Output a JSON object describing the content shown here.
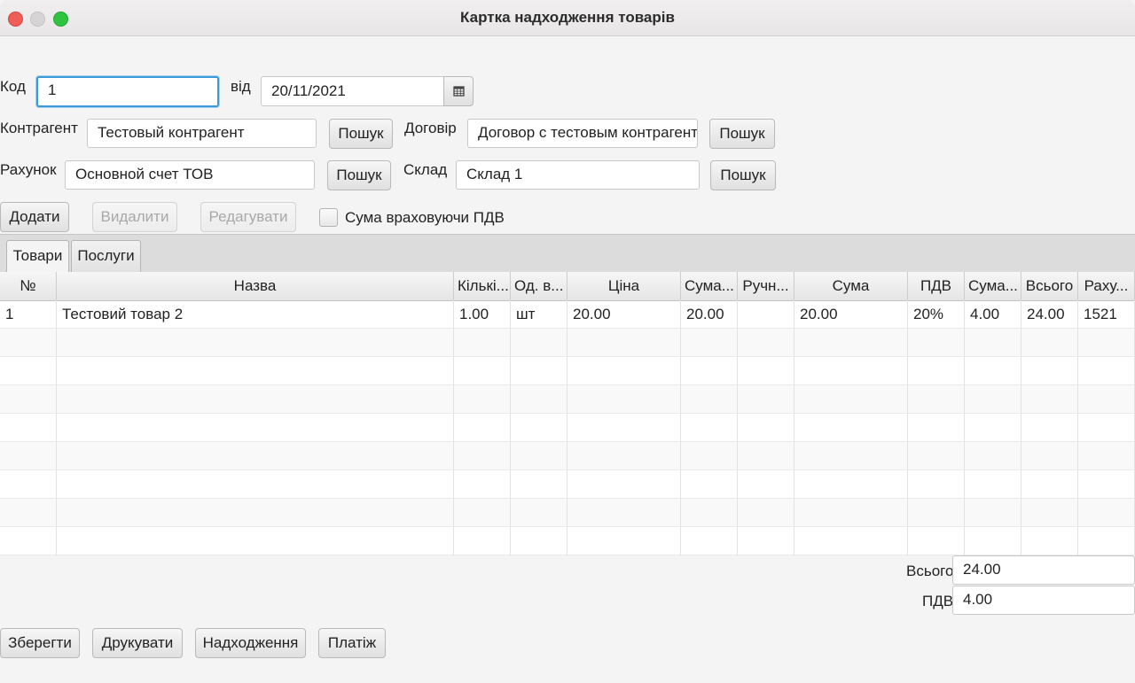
{
  "window": {
    "title": "Картка надходження товарів"
  },
  "form": {
    "code_label": "Код",
    "code_value": "1",
    "date_label": "від",
    "date_value": "20/11/2021",
    "counterparty_label": "Контрагент",
    "counterparty_value": "Тестовый контрагент",
    "contract_label": "Договір",
    "contract_value": "Договор с тестовым контрагент",
    "account_label": "Рахунок",
    "account_value": "Основной счет ТОВ",
    "warehouse_label": "Склад",
    "warehouse_value": "Склад 1",
    "search_label": "Пошук"
  },
  "toolbar": {
    "add_label": "Додати",
    "delete_label": "Видалити",
    "edit_label": "Редагувати",
    "vat_checkbox_label": "Сума враховуючи ПДВ",
    "vat_checkbox_checked": false
  },
  "tabs": [
    {
      "label": "Товари",
      "active": true
    },
    {
      "label": "Послуги",
      "active": false
    }
  ],
  "table": {
    "columns": [
      "№",
      "Назва",
      "Кількі...",
      "Од. в...",
      "Ціна",
      "Сума...",
      "Ручн...",
      "Сума",
      "ПДВ",
      "Сума...",
      "Всього",
      "Раху..."
    ],
    "rows": [
      [
        "1",
        "Тестовий товар 2",
        "1.00",
        "шт",
        "20.00",
        "20.00",
        "",
        "20.00",
        "20%",
        "4.00",
        "24.00",
        "1521"
      ]
    ]
  },
  "totals": {
    "total_label": "Всього",
    "total_value": "24.00",
    "vat_label": "ПДВ",
    "vat_value": "4.00"
  },
  "footer": {
    "save_label": "Зберегти",
    "print_label": "Друкувати",
    "receipt_label": "Надходження",
    "payment_label": "Платіж"
  }
}
